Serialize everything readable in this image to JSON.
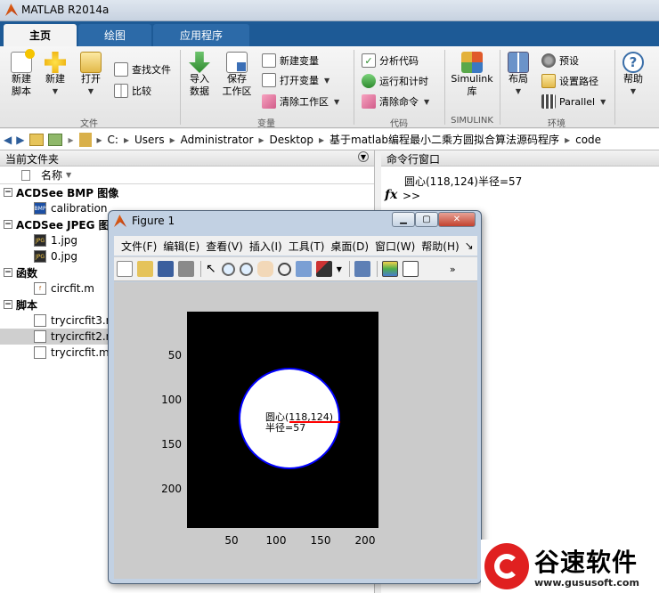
{
  "window": {
    "title": "MATLAB R2014a"
  },
  "tabs": [
    {
      "label": "主页"
    },
    {
      "label": "绘图"
    },
    {
      "label": "应用程序"
    }
  ],
  "ribbon": {
    "file": {
      "new_script": "新建\n脚本",
      "new": "新建",
      "open": "打开",
      "find_files": "查找文件",
      "compare": "比较",
      "group": "文件"
    },
    "variable": {
      "import": "导入\n数据",
      "save": "保存\n工作区",
      "new_var": "新建变量",
      "open_var": "打开变量",
      "clear_ws": "清除工作区",
      "group": "变量"
    },
    "code": {
      "analyze": "分析代码",
      "run_time": "运行和计时",
      "clear_cmd": "清除命令",
      "group": "代码"
    },
    "simulink": {
      "lib": "Simulink\n库",
      "group": "SIMULINK"
    },
    "env": {
      "layout": "布局",
      "prefs": "预设",
      "set_path": "设置路径",
      "parallel": "Parallel",
      "group": "环境"
    },
    "help": {
      "label": "帮助"
    }
  },
  "address": {
    "parts": [
      "C:",
      "Users",
      "Administrator",
      "Desktop",
      "基于matlab编程最小二乘方圆拟合算法源码程序",
      "code"
    ]
  },
  "current_folder": {
    "title": "当前文件夹",
    "col_name": "名称",
    "groups": [
      {
        "label": "ACDSee BMP 图像",
        "items": [
          "calibration"
        ]
      },
      {
        "label": "ACDSee JPEG 图像",
        "items": [
          "1.jpg",
          "0.jpg"
        ]
      },
      {
        "label": "函数",
        "items": [
          "circfit.m"
        ]
      },
      {
        "label": "脚本",
        "items": [
          "trycircfit3.m",
          "trycircfit2.m",
          "trycircfit.m"
        ]
      }
    ]
  },
  "command_window": {
    "title": "命令行窗口",
    "output": "圆心(118,124)半径=57",
    "prompt": ">>",
    "fx": "fx"
  },
  "figure": {
    "title": "Figure 1",
    "menu": [
      "文件(F)",
      "编辑(E)",
      "查看(V)",
      "插入(I)",
      "工具(T)",
      "桌面(D)",
      "窗口(W)",
      "帮助(H)"
    ],
    "x_ticks": [
      "50",
      "100",
      "150",
      "200"
    ],
    "y_ticks": [
      "50",
      "100",
      "150",
      "200"
    ],
    "center_label": "圆心(118,124)",
    "radius_label": "半径=57"
  },
  "watermark": {
    "brand": "谷速软件",
    "url": "www.gususoft.com"
  },
  "colors": {
    "tabbar": "#1d5a96",
    "circle_edge": "#0000ff",
    "radius_line": "#ff0000"
  }
}
